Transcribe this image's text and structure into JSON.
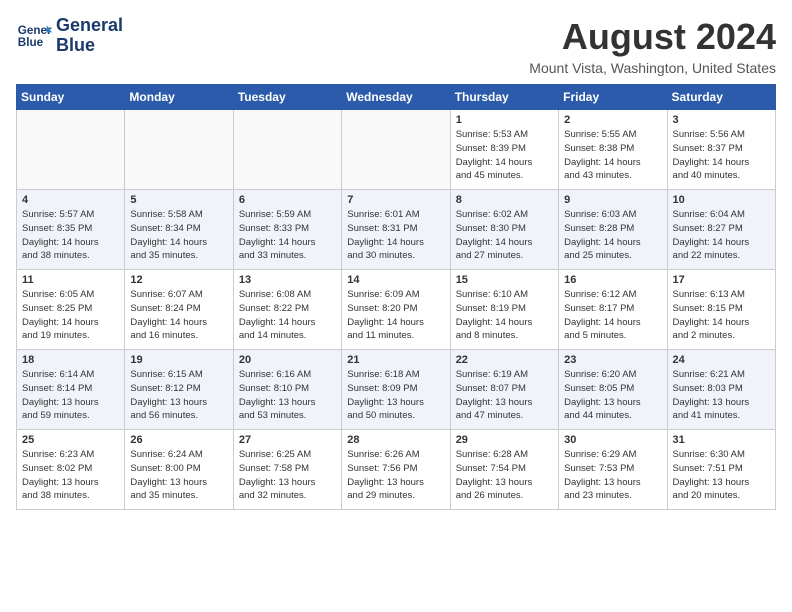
{
  "header": {
    "logo_line1": "General",
    "logo_line2": "Blue",
    "month_title": "August 2024",
    "location": "Mount Vista, Washington, United States"
  },
  "weekdays": [
    "Sunday",
    "Monday",
    "Tuesday",
    "Wednesday",
    "Thursday",
    "Friday",
    "Saturday"
  ],
  "weeks": [
    [
      {
        "day": "",
        "info": ""
      },
      {
        "day": "",
        "info": ""
      },
      {
        "day": "",
        "info": ""
      },
      {
        "day": "",
        "info": ""
      },
      {
        "day": "1",
        "info": "Sunrise: 5:53 AM\nSunset: 8:39 PM\nDaylight: 14 hours\nand 45 minutes."
      },
      {
        "day": "2",
        "info": "Sunrise: 5:55 AM\nSunset: 8:38 PM\nDaylight: 14 hours\nand 43 minutes."
      },
      {
        "day": "3",
        "info": "Sunrise: 5:56 AM\nSunset: 8:37 PM\nDaylight: 14 hours\nand 40 minutes."
      }
    ],
    [
      {
        "day": "4",
        "info": "Sunrise: 5:57 AM\nSunset: 8:35 PM\nDaylight: 14 hours\nand 38 minutes."
      },
      {
        "day": "5",
        "info": "Sunrise: 5:58 AM\nSunset: 8:34 PM\nDaylight: 14 hours\nand 35 minutes."
      },
      {
        "day": "6",
        "info": "Sunrise: 5:59 AM\nSunset: 8:33 PM\nDaylight: 14 hours\nand 33 minutes."
      },
      {
        "day": "7",
        "info": "Sunrise: 6:01 AM\nSunset: 8:31 PM\nDaylight: 14 hours\nand 30 minutes."
      },
      {
        "day": "8",
        "info": "Sunrise: 6:02 AM\nSunset: 8:30 PM\nDaylight: 14 hours\nand 27 minutes."
      },
      {
        "day": "9",
        "info": "Sunrise: 6:03 AM\nSunset: 8:28 PM\nDaylight: 14 hours\nand 25 minutes."
      },
      {
        "day": "10",
        "info": "Sunrise: 6:04 AM\nSunset: 8:27 PM\nDaylight: 14 hours\nand 22 minutes."
      }
    ],
    [
      {
        "day": "11",
        "info": "Sunrise: 6:05 AM\nSunset: 8:25 PM\nDaylight: 14 hours\nand 19 minutes."
      },
      {
        "day": "12",
        "info": "Sunrise: 6:07 AM\nSunset: 8:24 PM\nDaylight: 14 hours\nand 16 minutes."
      },
      {
        "day": "13",
        "info": "Sunrise: 6:08 AM\nSunset: 8:22 PM\nDaylight: 14 hours\nand 14 minutes."
      },
      {
        "day": "14",
        "info": "Sunrise: 6:09 AM\nSunset: 8:20 PM\nDaylight: 14 hours\nand 11 minutes."
      },
      {
        "day": "15",
        "info": "Sunrise: 6:10 AM\nSunset: 8:19 PM\nDaylight: 14 hours\nand 8 minutes."
      },
      {
        "day": "16",
        "info": "Sunrise: 6:12 AM\nSunset: 8:17 PM\nDaylight: 14 hours\nand 5 minutes."
      },
      {
        "day": "17",
        "info": "Sunrise: 6:13 AM\nSunset: 8:15 PM\nDaylight: 14 hours\nand 2 minutes."
      }
    ],
    [
      {
        "day": "18",
        "info": "Sunrise: 6:14 AM\nSunset: 8:14 PM\nDaylight: 13 hours\nand 59 minutes."
      },
      {
        "day": "19",
        "info": "Sunrise: 6:15 AM\nSunset: 8:12 PM\nDaylight: 13 hours\nand 56 minutes."
      },
      {
        "day": "20",
        "info": "Sunrise: 6:16 AM\nSunset: 8:10 PM\nDaylight: 13 hours\nand 53 minutes."
      },
      {
        "day": "21",
        "info": "Sunrise: 6:18 AM\nSunset: 8:09 PM\nDaylight: 13 hours\nand 50 minutes."
      },
      {
        "day": "22",
        "info": "Sunrise: 6:19 AM\nSunset: 8:07 PM\nDaylight: 13 hours\nand 47 minutes."
      },
      {
        "day": "23",
        "info": "Sunrise: 6:20 AM\nSunset: 8:05 PM\nDaylight: 13 hours\nand 44 minutes."
      },
      {
        "day": "24",
        "info": "Sunrise: 6:21 AM\nSunset: 8:03 PM\nDaylight: 13 hours\nand 41 minutes."
      }
    ],
    [
      {
        "day": "25",
        "info": "Sunrise: 6:23 AM\nSunset: 8:02 PM\nDaylight: 13 hours\nand 38 minutes."
      },
      {
        "day": "26",
        "info": "Sunrise: 6:24 AM\nSunset: 8:00 PM\nDaylight: 13 hours\nand 35 minutes."
      },
      {
        "day": "27",
        "info": "Sunrise: 6:25 AM\nSunset: 7:58 PM\nDaylight: 13 hours\nand 32 minutes."
      },
      {
        "day": "28",
        "info": "Sunrise: 6:26 AM\nSunset: 7:56 PM\nDaylight: 13 hours\nand 29 minutes."
      },
      {
        "day": "29",
        "info": "Sunrise: 6:28 AM\nSunset: 7:54 PM\nDaylight: 13 hours\nand 26 minutes."
      },
      {
        "day": "30",
        "info": "Sunrise: 6:29 AM\nSunset: 7:53 PM\nDaylight: 13 hours\nand 23 minutes."
      },
      {
        "day": "31",
        "info": "Sunrise: 6:30 AM\nSunset: 7:51 PM\nDaylight: 13 hours\nand 20 minutes."
      }
    ]
  ]
}
